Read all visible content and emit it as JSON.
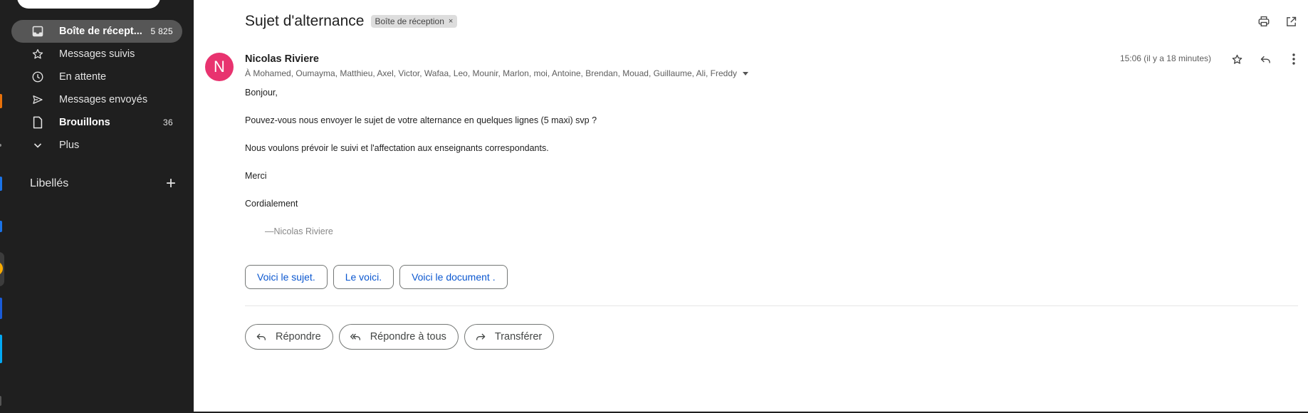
{
  "sidebar": {
    "items": [
      {
        "label": "Boîte de récept...",
        "count": "5 825",
        "icon": "inbox-icon"
      },
      {
        "label": "Messages suivis",
        "count": "",
        "icon": "star-icon"
      },
      {
        "label": "En attente",
        "count": "",
        "icon": "clock-icon"
      },
      {
        "label": "Messages envoyés",
        "count": "",
        "icon": "send-icon"
      },
      {
        "label": "Brouillons",
        "count": "36",
        "icon": "draft-icon"
      },
      {
        "label": "Plus",
        "count": "",
        "icon": "chevron-down-icon"
      }
    ],
    "labels_title": "Libellés",
    "labels_add": "+"
  },
  "email": {
    "subject": "Sujet d'alternance",
    "label_chip": "Boîte de réception",
    "chip_close": "×",
    "sender_initial": "N",
    "sender_name": "Nicolas Riviere",
    "recipients": "À Mohamed, Oumayma, Matthieu, Axel, Victor, Wafaa, Leo, Mounir, Marlon, moi, Antoine, Brendan, Mouad, Guillaume, Ali, Freddy",
    "time": "15:06 (il y a 18 minutes)",
    "body": [
      "Bonjour,",
      "Pouvez-vous nous envoyer le sujet de votre alternance en quelques lignes (5 maxi) svp ?",
      "Nous voulons prévoir le suivi et l'affectation aux enseignants correspondants.",
      "Merci",
      "Cordialement"
    ],
    "signature": "—Nicolas Riviere"
  },
  "smart_replies": [
    "Voici le sujet.",
    "Le voici.",
    "Voici le document ."
  ],
  "actions": {
    "reply": "Répondre",
    "reply_all": "Répondre à tous",
    "forward": "Transférer"
  },
  "colors": {
    "sidebar_bg": "#1f1f1f",
    "active_item_bg": "#565656",
    "avatar": "#e8336f",
    "smart_reply_text": "#0b57d0"
  }
}
